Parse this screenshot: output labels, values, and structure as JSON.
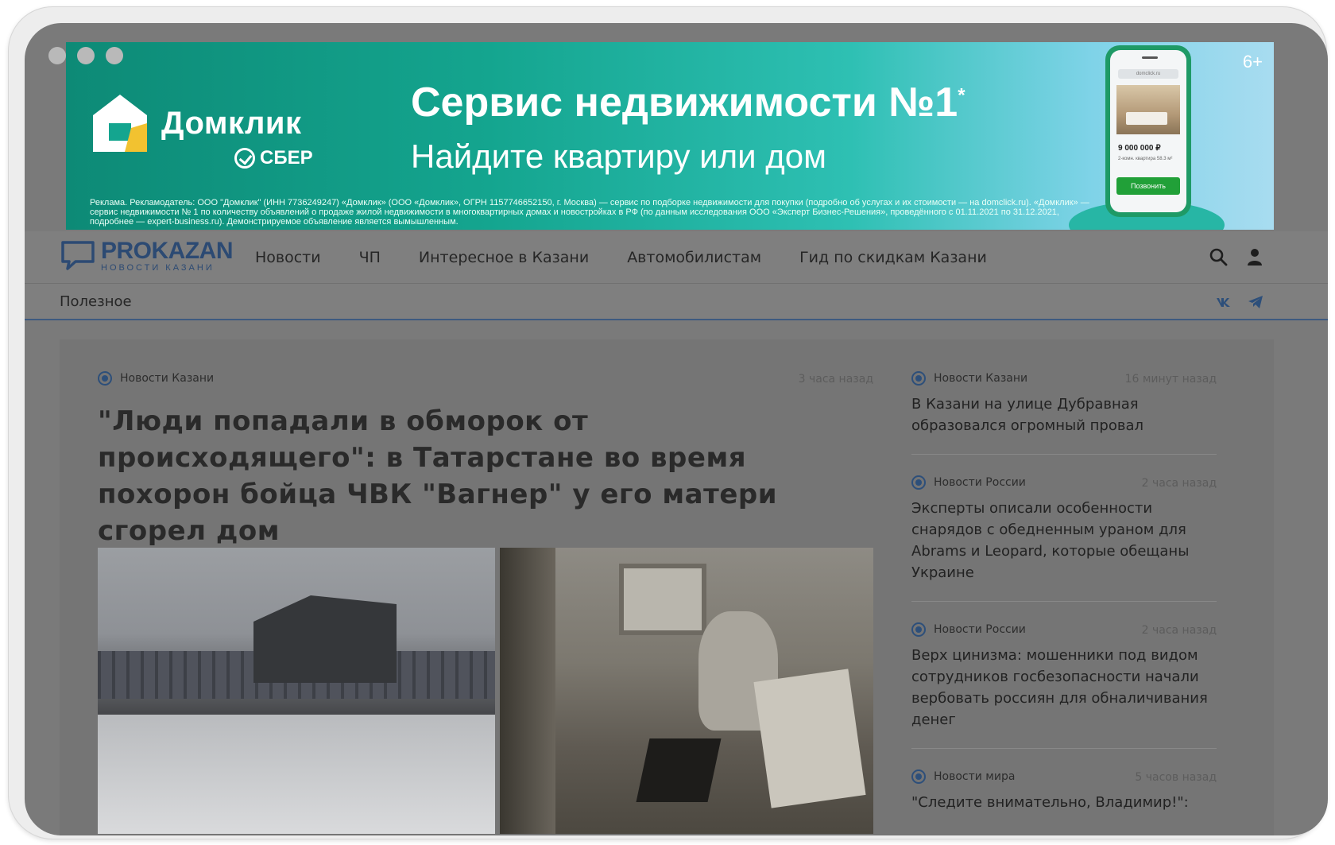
{
  "ad": {
    "brand": "Домклик",
    "sber": "СБЕР",
    "headline": "Сервис недвижимости №1",
    "headline_mark": "*",
    "subheadline": "Найдите квартиру или дом",
    "age": "6+",
    "legal": "Реклама. Рекламодатель: ООО \"Домклик\" (ИНН 7736249247) «Домклик» (ООО «Домклик», ОГРН 1157746652150, г. Москва) — сервис по подборке недвижимости для покупки (подробно об услугах и их стоимости — на domclick.ru). «Домклик» — сервис недвижимости № 1 по количеству объявлений о продаже жилой недвижимости в многоквартирных домах и новостройках в РФ (по данным исследования ООО «Эксперт Бизнес-Решения», проведённого с 01.11.2021 по 31.12.2021, подробнее — expert-business.ru). Демонстрируемое объявление является вымышленным.",
    "phone": {
      "url": "domclick.ru",
      "price": "9 000 000 ₽",
      "meta": "2-комн. квартира   58.3 м²",
      "button": "Позвонить"
    }
  },
  "header": {
    "logo_text": "PROKAZAN",
    "logo_sub": "НОВОСТИ КАЗАНИ",
    "nav": [
      "Новости",
      "ЧП",
      "Интересное в Казани",
      "Автомобилистам",
      "Гид по скидкам Казани"
    ],
    "sub_link": "Полезное"
  },
  "main_article": {
    "category": "Новости Казани",
    "time": "3 часа назад",
    "title": "\"Люди попадали в обморок от происходящего\": в Татарстане во время похорон бойца ЧВК \"Вагнер\" у его матери сгорел дом"
  },
  "sidebar": [
    {
      "category": "Новости Казани",
      "time": "16 минут назад",
      "title": "В Казани на улице Дубравная образовался огромный провал"
    },
    {
      "category": "Новости России",
      "time": "2 часа назад",
      "title": "Эксперты описали особенности снарядов с обедненным ураном для Abrams и Leopard, которые обещаны Украине"
    },
    {
      "category": "Новости России",
      "time": "2 часа назад",
      "title": "Верх цинизма: мошенники под видом сотрудников госбезопасности начали вербовать россиян для обналичивания денег"
    },
    {
      "category": "Новости мира",
      "time": "5 часов назад",
      "title": "\"Следите внимательно, Владимир!\":"
    }
  ],
  "colors": {
    "accent": "#2d4f7a",
    "overlay": "#7f7f7f"
  }
}
